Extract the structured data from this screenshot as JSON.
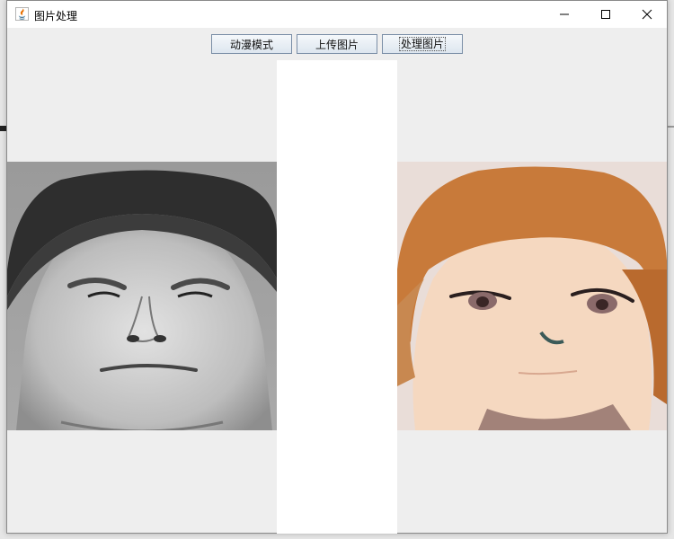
{
  "window": {
    "title": "图片处理",
    "controls": {
      "minimize": "minimize-icon",
      "maximize": "maximize-icon",
      "close": "close-icon"
    }
  },
  "toolbar": {
    "mode_label": "动漫模式",
    "upload_label": "上传图片",
    "process_label": "处理图片"
  },
  "images": {
    "original": "grayscale-portrait",
    "processed": "anime-style-portrait"
  },
  "colors": {
    "title_bg": "#ffffff",
    "panel_bg": "#eeeeee",
    "center_bg": "#ffffff",
    "button_border": "#7a8ea6"
  }
}
